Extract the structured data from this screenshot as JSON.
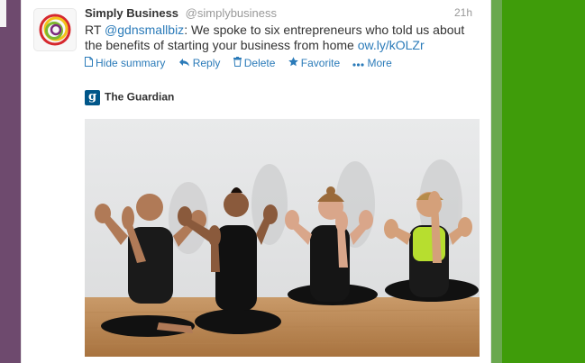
{
  "tweet": {
    "author_name": "Simply Business",
    "handle": "@simplybusiness",
    "time": "21h",
    "text_prefix": "RT ",
    "mention": "@gdnsmallbiz",
    "text_body": ": We spoke to six entrepreneurs who told us about the benefits of starting your business from home ",
    "link": "ow.ly/kOLZr"
  },
  "actions": {
    "hide_summary": "Hide summary",
    "reply": "Reply",
    "delete": "Delete",
    "favorite": "Favorite",
    "more": "More"
  },
  "source": {
    "logo_letter": "g",
    "name": "The Guardian"
  },
  "icons": {
    "hide_summary": "document-icon",
    "reply": "reply-arrow-icon",
    "delete": "trash-icon",
    "favorite": "star-icon",
    "more": "dots-icon"
  },
  "colors": {
    "link": "#2b7bb9",
    "sidebar_left": "#6e4a6e",
    "sidebar_right": "#3f9c0a",
    "guardian_blue": "#005689"
  }
}
